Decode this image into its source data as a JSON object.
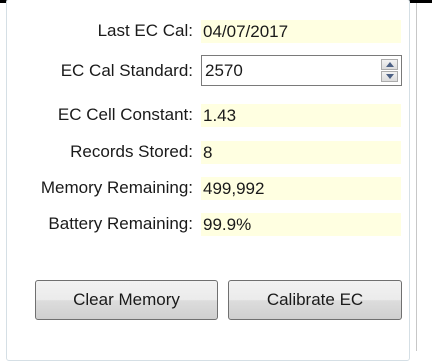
{
  "fields": [
    {
      "label": "Last EC Cal:",
      "value": "04/07/2017"
    },
    {
      "label": "EC Cal Standard:",
      "value": "2570"
    },
    {
      "label": "EC Cell Constant:",
      "value": "1.43"
    },
    {
      "label": "Records Stored:",
      "value": "8"
    },
    {
      "label": "Memory Remaining:",
      "value": "499,992"
    },
    {
      "label": "Battery Remaining:",
      "value": "99.9%"
    }
  ],
  "buttons": {
    "clear_memory": "Clear Memory",
    "calibrate_ec": "Calibrate EC"
  },
  "colors": {
    "readonly_bg": "#ffffe1",
    "top_border": "#000000"
  }
}
